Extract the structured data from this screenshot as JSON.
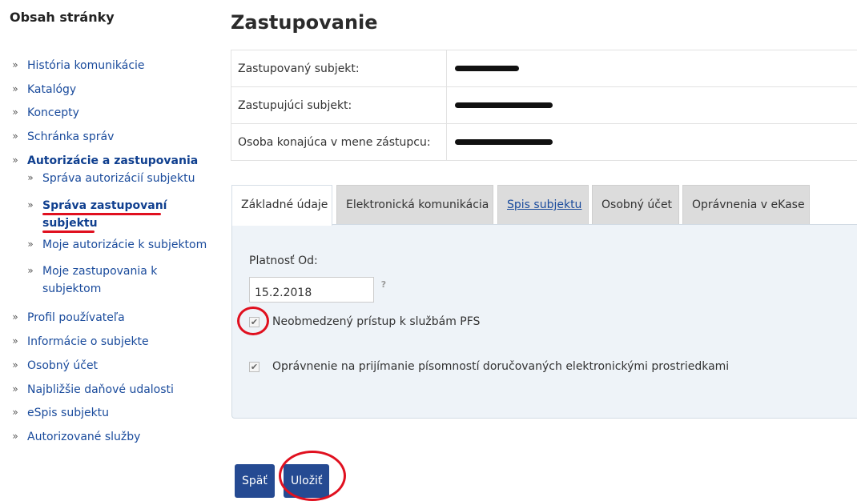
{
  "sidebar": {
    "title": "Obsah stránky",
    "items": [
      {
        "label": "História komunikácie"
      },
      {
        "label": "Katalógy"
      },
      {
        "label": "Koncepty"
      },
      {
        "label": "Schránka správ"
      },
      {
        "label": "Autorizácie a zastupovania",
        "expanded": true
      },
      {
        "label": "Správa autorizácií subjektu"
      },
      {
        "label_line1": "Správa zastupovaní",
        "label_line2": "subjektu",
        "active": true
      },
      {
        "label": "Moje autorizácie k subjektom"
      },
      {
        "label_line1": "Moje zastupovania k",
        "label_line2": "subjektom"
      },
      {
        "label": "Profil používateľa"
      },
      {
        "label": "Informácie o subjekte"
      },
      {
        "label": "Osobný účet"
      },
      {
        "label": "Najbližšie daňové udalosti"
      },
      {
        "label": "eSpis subjektu"
      },
      {
        "label": "Autorizované služby"
      }
    ]
  },
  "page": {
    "title": "Zastupovanie"
  },
  "info": {
    "rows": [
      {
        "label": "Zastupovaný subjekt:"
      },
      {
        "label": "Zastupujúci subjekt:"
      },
      {
        "label": "Osoba konajúca v mene zástupcu:"
      }
    ]
  },
  "tabs": [
    {
      "label": "Základné údaje",
      "active": true
    },
    {
      "label": "Elektronická komunikácia"
    },
    {
      "label": "Spis subjektu"
    },
    {
      "label": "Osobný účet"
    },
    {
      "label": "Oprávnenia v eKase"
    }
  ],
  "form": {
    "validity_label": "Platnosť Od:",
    "validity_value": "15.2.2018",
    "help_icon": "question-icon",
    "unrestricted_access": {
      "label": "Neobmedzený prístup k službám PFS",
      "checked": true
    },
    "receive_documents": {
      "label": "Oprávnenie na prijímanie písomností doručovaných elektronickými prostriedkami",
      "checked": true
    }
  },
  "buttons": {
    "back_label": "Späť",
    "save_label": "Uložiť"
  },
  "colors": {
    "link": "#1a4b9c",
    "button": "#254a92",
    "annotation_red": "#e0101f",
    "panel_bg": "#eef3f8",
    "inactive_tab": "#dcdcdc"
  }
}
